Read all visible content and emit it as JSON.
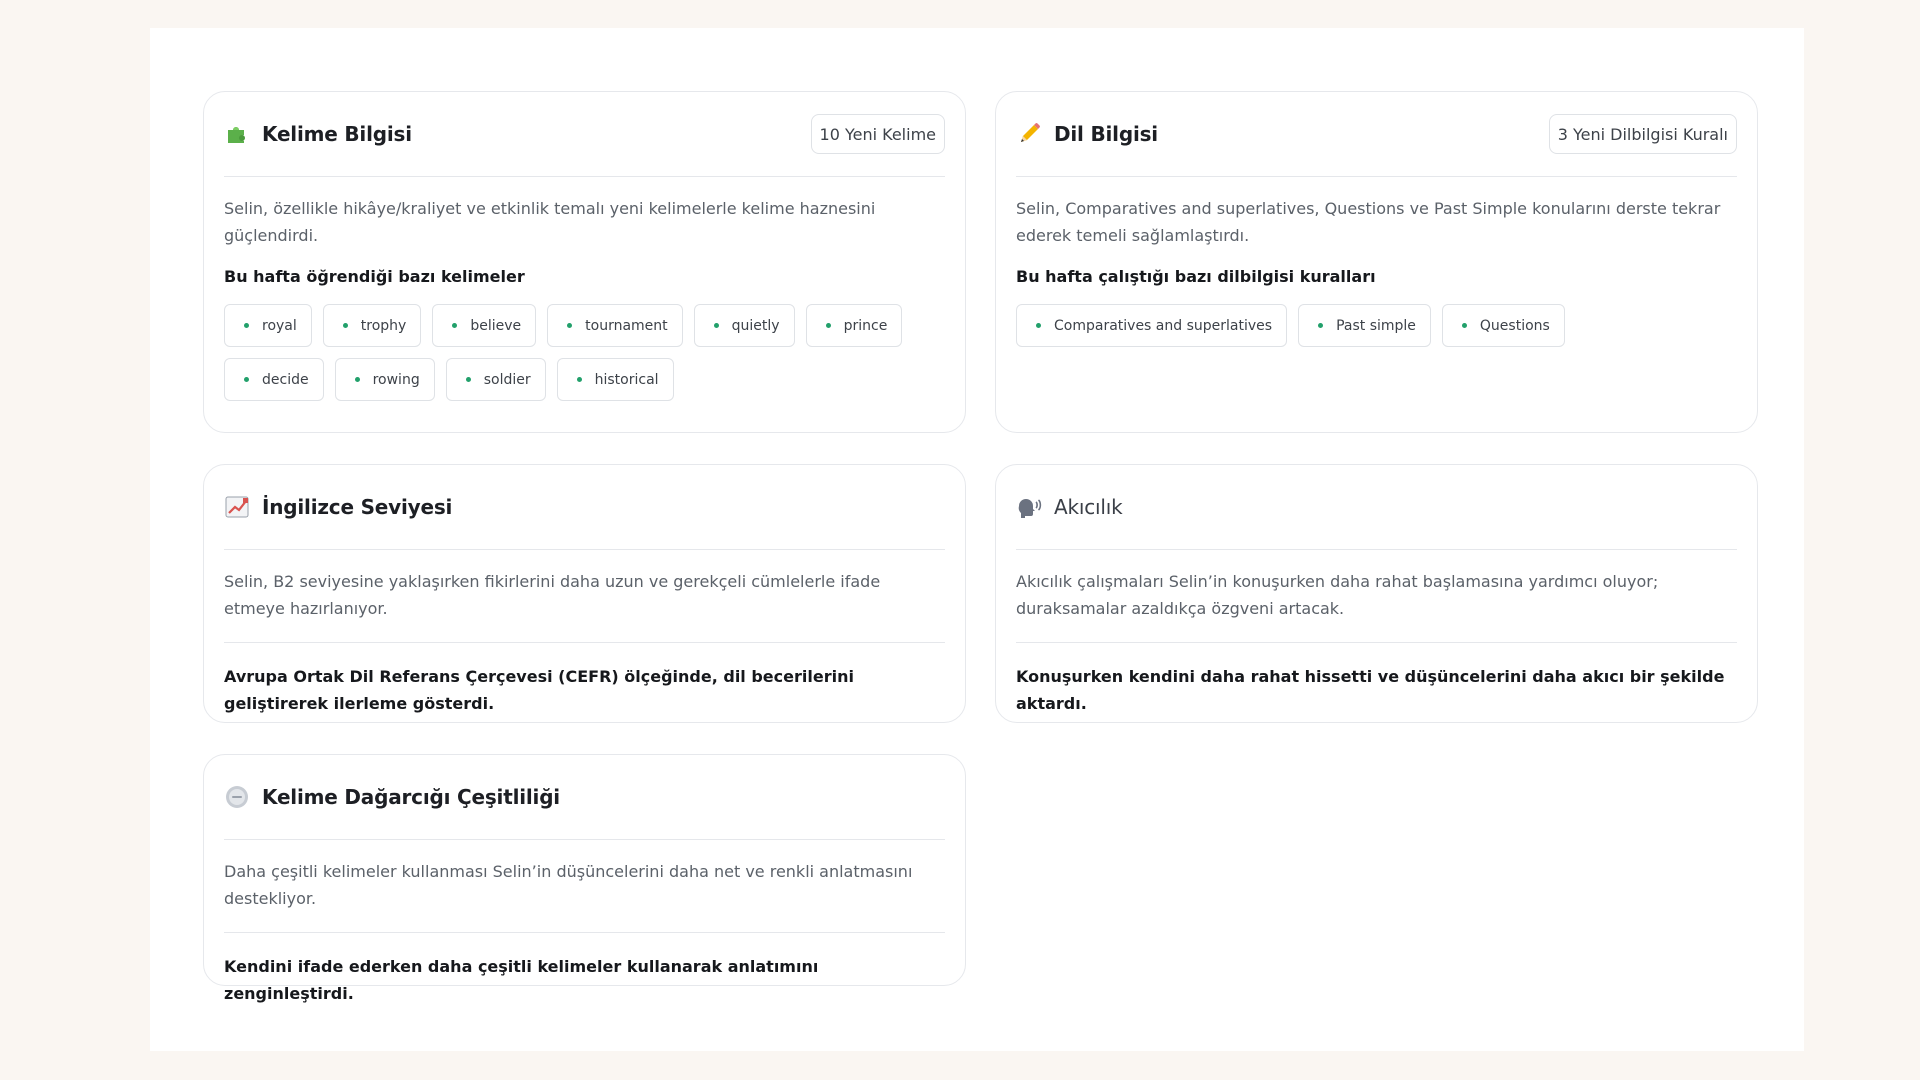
{
  "vocabulary": {
    "icon": "puzzle-icon",
    "title": "Kelime Bilgisi",
    "badge": "10 Yeni Kelime",
    "description": "Selin, özellikle hikâye/kraliyet ve etkinlik temalı yeni kelimelerle kelime haznesini güçlendirdi.",
    "subheading": "Bu hafta öğrendiği bazı kelimeler",
    "words": [
      "royal",
      "trophy",
      "believe",
      "tournament",
      "quietly",
      "prince",
      "decide",
      "rowing",
      "soldier",
      "historical"
    ]
  },
  "grammar": {
    "icon": "pencil-icon",
    "title": "Dil Bilgisi",
    "badge": "3 Yeni Dilbilgisi Kuralı",
    "description": "Selin, Comparatives and superlatives, Questions ve Past Simple konularını derste tekrar ederek temeli sağlamlaştırdı.",
    "subheading": "Bu hafta çalıştığı bazı dilbilgisi kuralları",
    "rules": [
      "Comparatives and superlatives",
      "Past simple",
      "Questions"
    ]
  },
  "level": {
    "icon": "chart-increasing-icon",
    "title": "İngilizce Seviyesi",
    "description": "Selin, B2 seviyesine yaklaşırken fikirlerini daha uzun ve gerekçeli cümlelerle ifade etmeye hazırlanıyor.",
    "statement": "Avrupa Ortak Dil Referans Çerçevesi (CEFR) ölçeğinde, dil becerilerini geliştirerek ilerleme gösterdi."
  },
  "fluency": {
    "icon": "speaking-head-icon",
    "title": "Akıcılık",
    "description": "Akıcılık çalışmaları Selin’in konuşurken daha rahat başlamasına yardımcı oluyor; duraksamalar azaldıkça özgveni artacak.",
    "statement": "Konuşurken kendini daha rahat hissetti ve düşüncelerini daha akıcı bir şekilde aktardı."
  },
  "variety": {
    "icon": "circle-badge-icon",
    "title": "Kelime Dağarcığı Çeşitliliği",
    "description": "Daha çeşitli kelimeler kullanması Selin’in düşüncelerini daha net ve renkli anlatmasını destekliyor.",
    "statement": "Kendini ifade ederken daha çeşitli kelimeler kullanarak anlatımını zenginleştirdi."
  },
  "colors": {
    "page_background": "#faf6f2",
    "card_border": "#e6e8ec",
    "chip_dot": "#22a06b"
  }
}
